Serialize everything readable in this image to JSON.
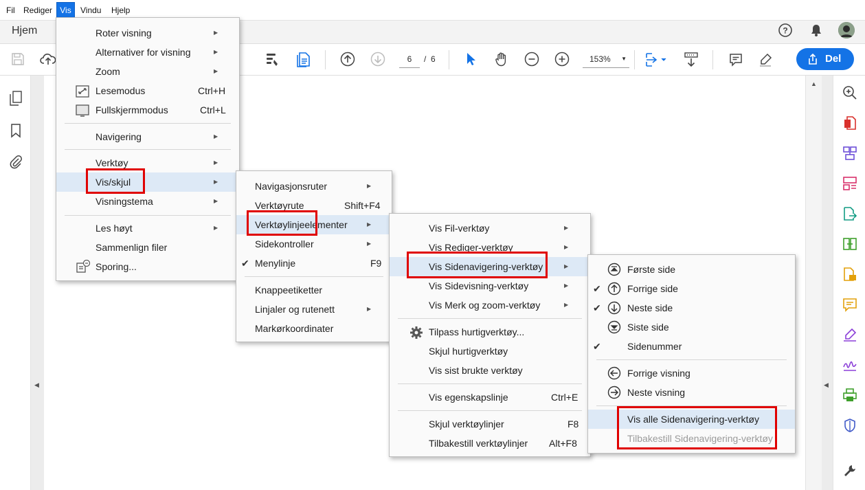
{
  "menubar": {
    "items": [
      "Fil",
      "Rediger",
      "Vis",
      "Vindu",
      "Hjelp"
    ]
  },
  "tabbar": {
    "home_label": "Hjem"
  },
  "toolbar": {
    "page_current": "6",
    "page_sep": "/",
    "page_total": "6",
    "zoom": "153%",
    "share_label": "Del"
  },
  "vis_menu": {
    "items": [
      {
        "label": "Roter visning",
        "u": "v"
      },
      {
        "label": "Alternativer for visning",
        "u": "v"
      },
      {
        "label": "Zoom",
        "u": "Z"
      },
      {
        "label": "Lesemodus",
        "shortcut": "Ctrl+H"
      },
      {
        "label": "Fullskjermmodus",
        "shortcut": "Ctrl+L"
      },
      {
        "label": "Navigering"
      },
      {
        "label": "Verktøy"
      },
      {
        "label": "Vis/skjul"
      },
      {
        "label": "Visningstema"
      },
      {
        "label": "Les høyt"
      },
      {
        "label": "Sammenlign filer"
      },
      {
        "label": "Sporing..."
      }
    ]
  },
  "visskjul_menu": {
    "items": [
      {
        "label": "Navigasjonsruter"
      },
      {
        "label": "Verktøyrute",
        "shortcut": "Shift+F4"
      },
      {
        "label": "Verktøylinjeelementer"
      },
      {
        "label": "Sidekontroller"
      },
      {
        "label": "Menylinje",
        "shortcut": "F9"
      },
      {
        "label": "Knappeetiketter"
      },
      {
        "label": "Linjaler og rutenett"
      },
      {
        "label": "Markørkoordinater"
      }
    ]
  },
  "toolbar_items_menu": {
    "items": [
      {
        "label": "Vis Fil-verktøy"
      },
      {
        "label": "Vis Rediger-verktøy"
      },
      {
        "label": "Vis Sidenavigering-verktøy"
      },
      {
        "label": "Vis Sidevisning-verktøy"
      },
      {
        "label": "Vis Merk og zoom-verktøy"
      },
      {
        "label": "Tilpass hurtigverktøy..."
      },
      {
        "label": "Skjul hurtigverktøy"
      },
      {
        "label": "Vis sist brukte verktøy"
      },
      {
        "label": "Vis egenskapslinje",
        "shortcut": "Ctrl+E"
      },
      {
        "label": "Skjul verktøylinjer",
        "shortcut": "F8"
      },
      {
        "label": "Tilbakestill verktøylinjer",
        "shortcut": "Alt+F8"
      }
    ]
  },
  "pagenav_menu": {
    "items": [
      {
        "label": "Første side"
      },
      {
        "label": "Forrige side"
      },
      {
        "label": "Neste side"
      },
      {
        "label": "Siste side"
      },
      {
        "label": "Sidenummer"
      },
      {
        "label": "Forrige visning"
      },
      {
        "label": "Neste visning"
      },
      {
        "label": "Vis alle Sidenavigering-verktøy"
      },
      {
        "label": "Tilbakestill Sidenavigering-verktøy"
      }
    ]
  },
  "colors": {
    "accent": "#1473e6",
    "highlight_box": "#e00000",
    "menu_hover": "#dde9f6"
  }
}
